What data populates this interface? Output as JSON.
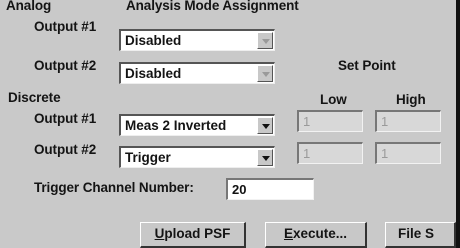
{
  "analog": {
    "section_label": "Analog",
    "assignment_label": "Analysis Mode Assignment",
    "outputs": [
      {
        "label": "Output #1",
        "value": "Disabled"
      },
      {
        "label": "Output #2",
        "value": "Disabled"
      }
    ]
  },
  "set_point": {
    "label": "Set Point",
    "low_label": "Low",
    "high_label": "High"
  },
  "discrete": {
    "section_label": "Discrete",
    "outputs": [
      {
        "label": "Output #1",
        "value": "Meas 2 Inverted",
        "low": "1",
        "high": "1"
      },
      {
        "label": "Output #2",
        "value": "Trigger",
        "low": "1",
        "high": "1"
      }
    ]
  },
  "trigger": {
    "label": "Trigger Channel Number:",
    "value": "20"
  },
  "buttons": {
    "upload_first": "U",
    "upload_rest": "pload PSF",
    "execute_first": "E",
    "execute_rest": "xecute...",
    "file_prefix": "File S"
  }
}
